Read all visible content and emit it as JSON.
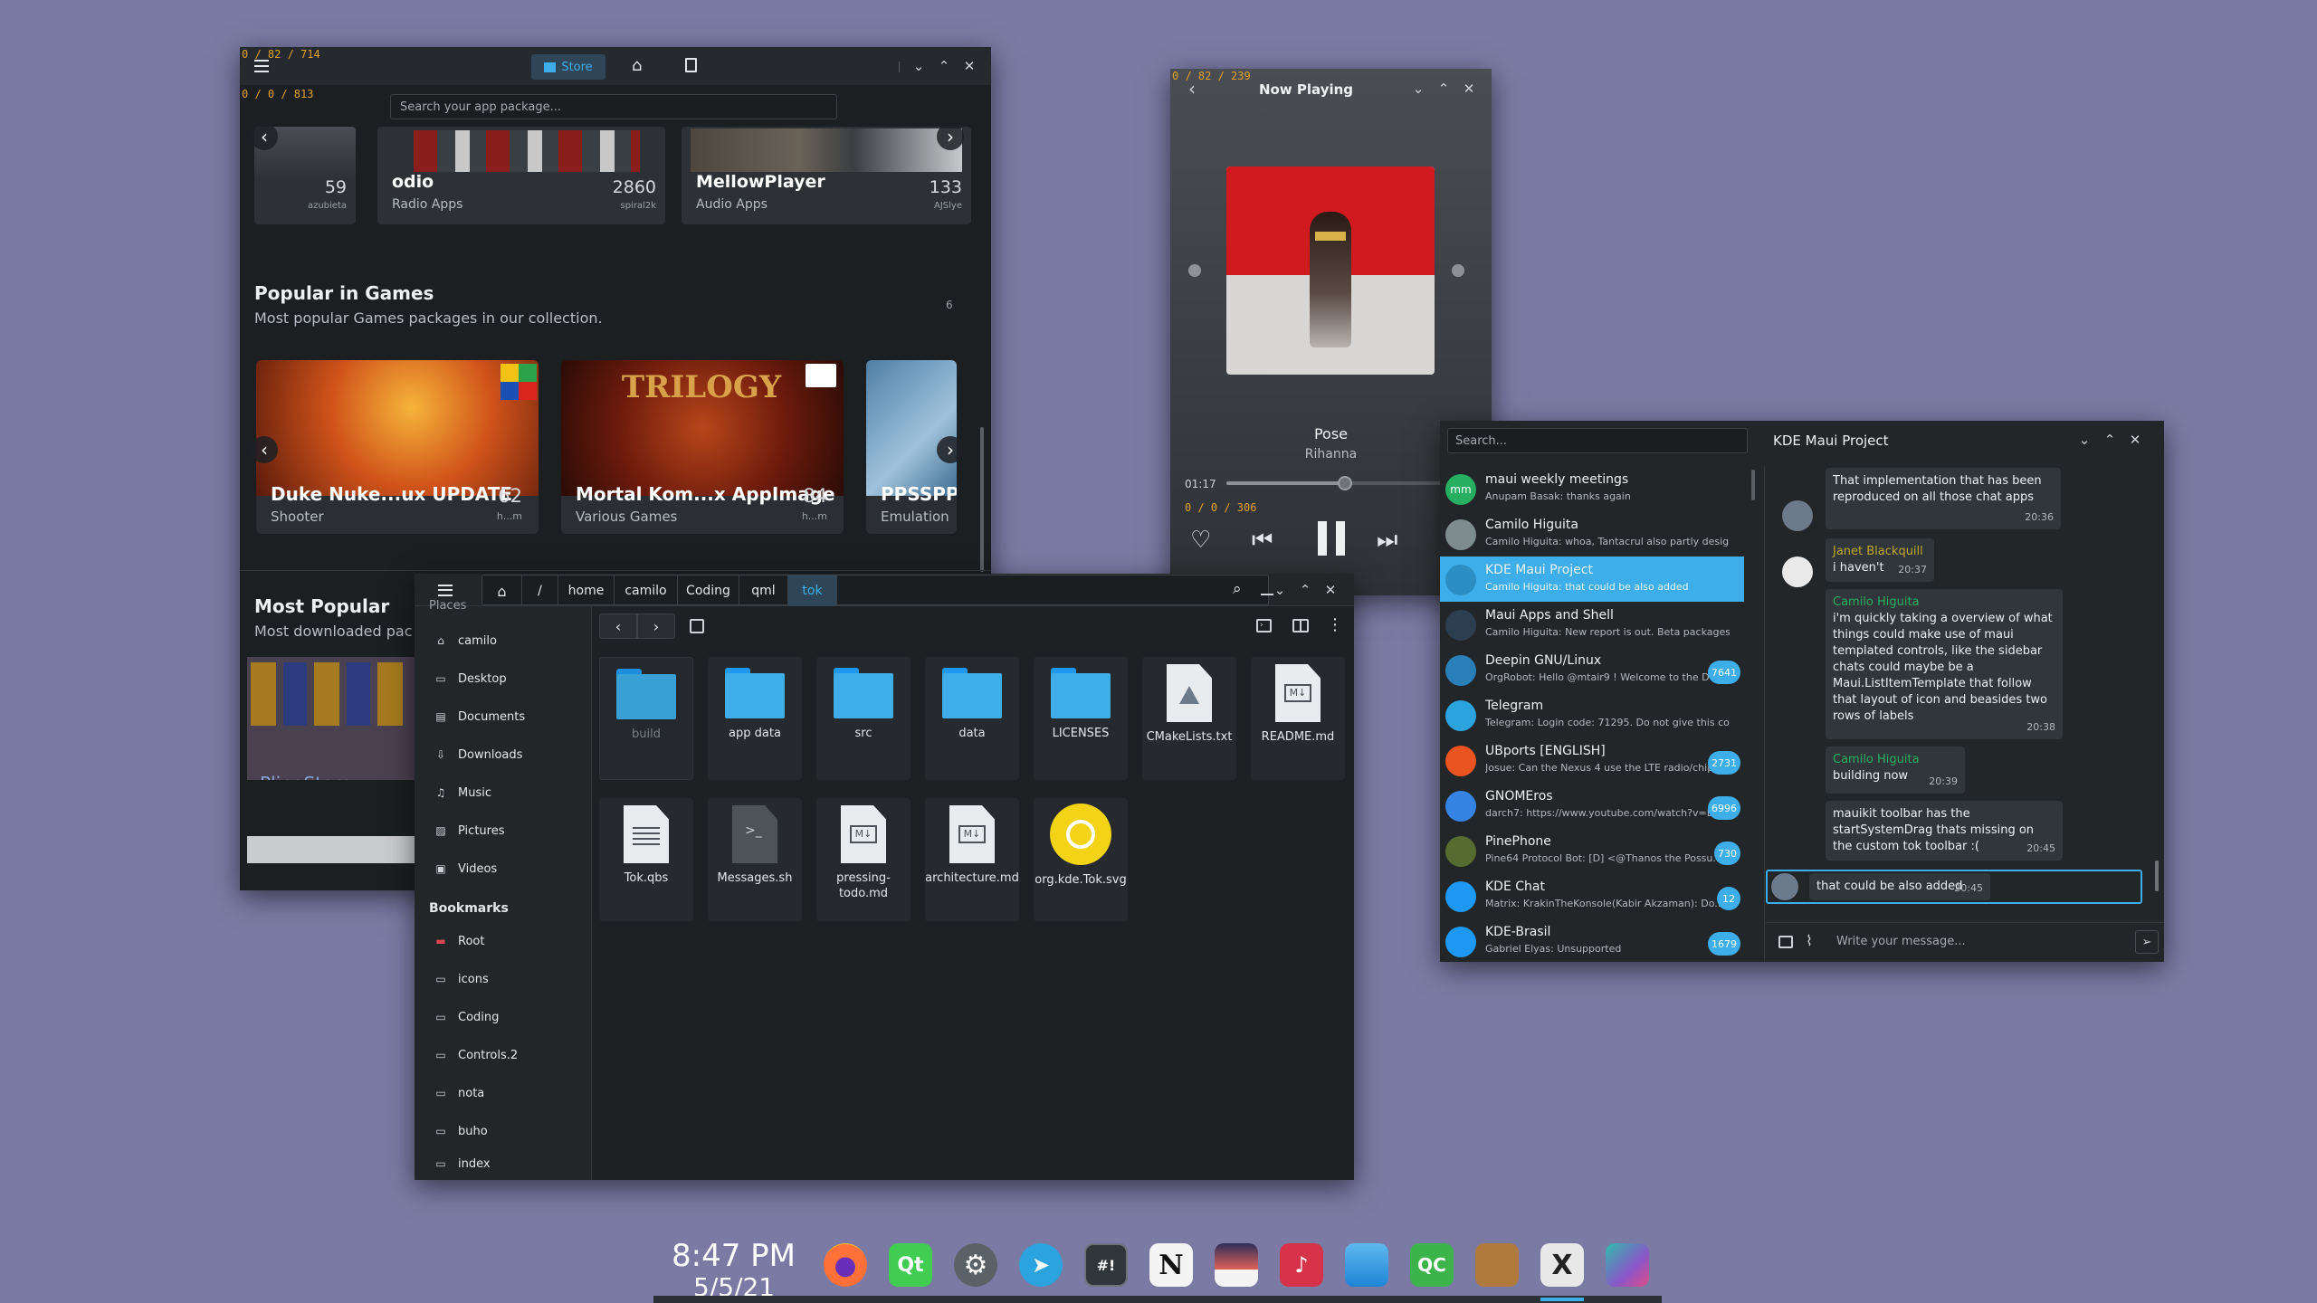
{
  "store": {
    "debug_top": "0 / 82 / 714",
    "debug_left": "0 / 0 / 813",
    "store_tab": "Store",
    "search_placeholder": "Search your app package...",
    "categories": [
      {
        "title": "",
        "subtitle": "",
        "count": "59",
        "user": "azubieta"
      },
      {
        "title": "odio",
        "subtitle": "Radio Apps",
        "count": "2860",
        "user": "spiral2k"
      },
      {
        "title": "MellowPlayer",
        "subtitle": "Audio Apps",
        "count": "133",
        "user": "AJSlye"
      }
    ],
    "games_title": "Popular in Games",
    "games_subtitle": "Most popular Games packages in our collection.",
    "games_count": "6",
    "games": [
      {
        "title": "Duke Nuke...ux UPDATE",
        "subtitle": "Shooter",
        "count": "62",
        "user": "h...m"
      },
      {
        "title": "Mortal Kom...x AppImage",
        "subtitle": "Various Games",
        "count": "84",
        "user": "h...m"
      },
      {
        "title": "PPSSPP",
        "subtitle": "Emulation",
        "count": "",
        "user": ""
      }
    ],
    "popular_title": "Most Popular",
    "popular_subtitle": "Most downloaded pac",
    "pling_label": "PlingStore"
  },
  "player": {
    "debug": "0 / 82 / 239",
    "title": "Now Playing",
    "track": "Pose",
    "artist": "Rihanna",
    "elapsed": "01:17",
    "progress": 0.45,
    "debug2": "0 / 0 / 306"
  },
  "files": {
    "breadcrumbs": [
      "/",
      "home",
      "camilo",
      "Coding",
      "qml",
      "tok"
    ],
    "places_header": "Places",
    "places": [
      {
        "label": "camilo",
        "icon": "home-icon"
      },
      {
        "label": "Desktop",
        "icon": "desktop-icon"
      },
      {
        "label": "Documents",
        "icon": "documents-icon"
      },
      {
        "label": "Downloads",
        "icon": "downloads-icon"
      },
      {
        "label": "Music",
        "icon": "music-icon"
      },
      {
        "label": "Pictures",
        "icon": "pictures-icon"
      },
      {
        "label": "Videos",
        "icon": "videos-icon"
      }
    ],
    "bookmarks_header": "Bookmarks",
    "bookmarks": [
      "Root",
      "icons",
      "Coding",
      "Controls.2",
      "nota",
      "buho",
      "index"
    ],
    "items": [
      {
        "label": "build",
        "kind": "folder"
      },
      {
        "label": "app data",
        "kind": "folder"
      },
      {
        "label": "src",
        "kind": "folder"
      },
      {
        "label": "data",
        "kind": "folder"
      },
      {
        "label": "LICENSES",
        "kind": "folder"
      },
      {
        "label": "CMakeLists.txt",
        "kind": "cmake"
      },
      {
        "label": "README.md",
        "kind": "markdown"
      },
      {
        "label": "Tok.qbs",
        "kind": "text"
      },
      {
        "label": "Messages.sh",
        "kind": "script"
      },
      {
        "label": "pressing-todo.md",
        "kind": "markdown"
      },
      {
        "label": "architecture.md",
        "kind": "markdown"
      },
      {
        "label": "org.kde.Tok.svg",
        "kind": "svg"
      }
    ]
  },
  "chat": {
    "search_placeholder": "Search...",
    "title": "KDE Maui Project",
    "composer_placeholder": "Write your message...",
    "list": [
      {
        "name": "maui weekly meetings",
        "preview": "Anupam Basak: thanks again",
        "badge": "",
        "color": "#27ae60",
        "initials": "mm"
      },
      {
        "name": "Camilo Higuita",
        "preview": "Camilo Higuita: whoa, Tantacrul also partly designe...",
        "badge": "",
        "color": "#7f8c8d",
        "initials": ""
      },
      {
        "name": "KDE Maui Project",
        "preview": "Camilo Higuita: that could be also added",
        "badge": "",
        "color": "#3daee9",
        "initials": ""
      },
      {
        "name": "Maui Apps and Shell",
        "preview": "Camilo Higuita: New report is out. Beta packages c...",
        "badge": "",
        "color": "#2c3e50",
        "initials": ""
      },
      {
        "name": "Deepin GNU/Linux",
        "preview": "OrgRobot: Hello @mtair9 ! Welcome to the De...",
        "badge": "7641",
        "color": "#2980b9",
        "initials": ""
      },
      {
        "name": "Telegram",
        "preview": "Telegram: Login code: 71295. Do not give this code...",
        "badge": "",
        "color": "#2aa3df",
        "initials": ""
      },
      {
        "name": "UBports [ENGLISH]",
        "preview": "Josue: Can the Nexus 4 use the LTE radio/chip ...",
        "badge": "2731",
        "color": "#e95420",
        "initials": ""
      },
      {
        "name": "GNOMEros",
        "preview": "darch7: https://www.youtube.com/watch?v=B...",
        "badge": "6996",
        "color": "#3584e4",
        "initials": ""
      },
      {
        "name": "PinePhone",
        "preview": "Pine64 Protocol Bot: [D] <@Thanos the Possu...",
        "badge": "730",
        "color": "#556b2f",
        "initials": ""
      },
      {
        "name": "KDE Chat",
        "preview": "Matrix: KrakinTheKonsole(Kabir Akzaman): Do...",
        "badge": "12",
        "color": "#1d99f3",
        "initials": ""
      },
      {
        "name": "KDE-Brasil",
        "preview": "Gabriel Elyas: Unsupported",
        "badge": "1679",
        "color": "#1d99f3",
        "initials": ""
      }
    ],
    "messages": [
      {
        "who": "",
        "text": "That implementation  that has been reproduced on all those chat apps",
        "time": "20:36"
      },
      {
        "who": "Janet Blackquill",
        "text": "i haven't",
        "time": "20:37"
      },
      {
        "who": "Camilo Higuita",
        "text": "i'm quickly taking a overview of what things could make use of maui templated controls, like the sidebar chats could maybe be a Maui.ListItemTemplate that follow that layout of icon and beasides two rows of labels",
        "time": "20:38"
      },
      {
        "who": "Camilo Higuita",
        "text": "building now",
        "time": "20:39"
      },
      {
        "who": "",
        "text": "mauikit toolbar has the startSystemDrag thats missing on the custom tok toolbar :(",
        "time": "20:45"
      },
      {
        "who": "",
        "text": "that could be also added",
        "time": "20:45"
      }
    ]
  },
  "dock": {
    "time": "8:47 PM",
    "date": "5/5/21",
    "apps": [
      "firefox-icon",
      "qt-creator-icon",
      "system-settings-icon",
      "telegram-icon",
      "terminal-icon",
      "notion-icon",
      "image-viewer-icon",
      "audio-app-icon",
      "file-manager-icon",
      "qc-icon",
      "archive-icon",
      "x-app-icon",
      "kde-app-icon"
    ]
  }
}
